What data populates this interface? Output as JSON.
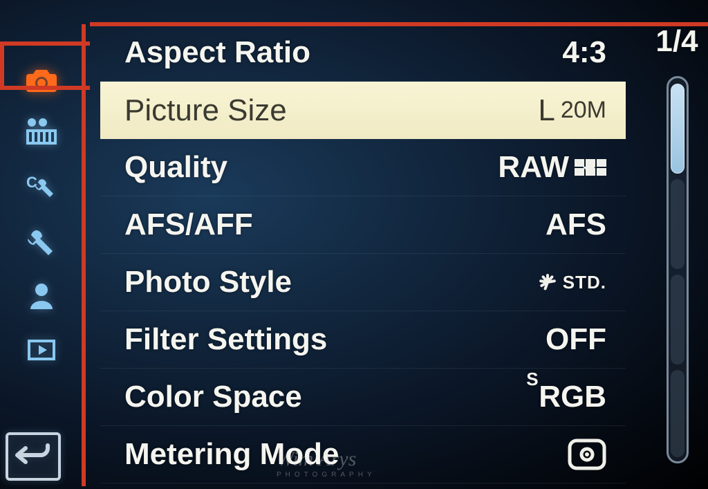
{
  "page_indicator": "1/4",
  "sidebar": {
    "items": [
      {
        "name": "rec-tab",
        "icon": "camera",
        "active": true
      },
      {
        "name": "motion-picture-tab",
        "icon": "video",
        "active": false
      },
      {
        "name": "custom-tab",
        "icon": "wrench-c",
        "active": false
      },
      {
        "name": "setup-tab",
        "icon": "wrench",
        "active": false
      },
      {
        "name": "my-menu-tab",
        "icon": "person",
        "active": false
      },
      {
        "name": "playback-tab",
        "icon": "playback",
        "active": false
      }
    ]
  },
  "menu": {
    "items": [
      {
        "label": "Aspect Ratio",
        "value": "4:3",
        "selected": false
      },
      {
        "label": "Picture Size",
        "value": "L",
        "value_sub": "20M",
        "selected": true
      },
      {
        "label": "Quality",
        "value": "RAW",
        "value_icon": "raw-fine",
        "selected": false
      },
      {
        "label": "AFS/AFF",
        "value": "AFS",
        "selected": false
      },
      {
        "label": "Photo Style",
        "value": "STD.",
        "value_icon": "burst",
        "selected": false
      },
      {
        "label": "Filter Settings",
        "value": "OFF",
        "selected": false
      },
      {
        "label": "Color Space",
        "value": "RGB",
        "value_prefix": "S",
        "value_icon": "srgb",
        "selected": false
      },
      {
        "label": "Metering Mode",
        "value": "",
        "value_icon": "metering-multi",
        "selected": false
      }
    ]
  },
  "scrollbar": {
    "segments": 4,
    "active": 1
  },
  "watermark": {
    "text": "Wim Arys",
    "subtext": "PHOTOGRAPHY"
  }
}
